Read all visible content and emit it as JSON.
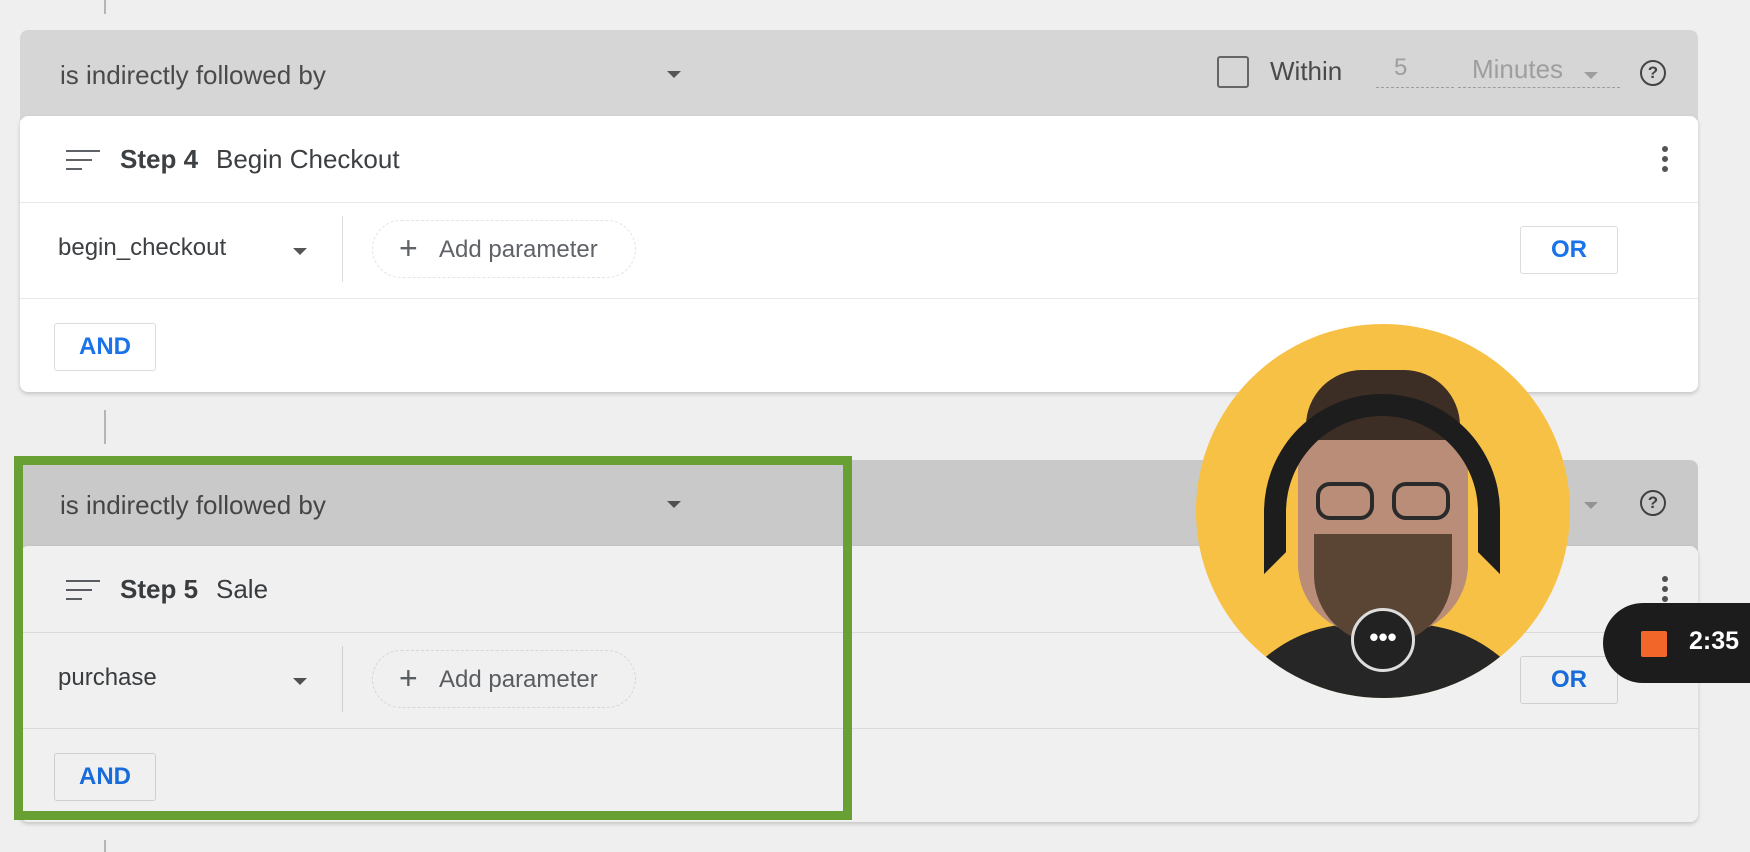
{
  "block1": {
    "condition": "is indirectly followed by",
    "within": {
      "label": "Within",
      "value": "5",
      "unit": "Minutes",
      "checked": false
    },
    "step": {
      "number_label": "Step 4",
      "name": "Begin Checkout"
    },
    "event": "begin_checkout",
    "add_parameter": "Add parameter",
    "or_label": "OR",
    "and_label": "AND"
  },
  "block2": {
    "condition": "is indirectly followed by",
    "step": {
      "number_label": "Step 5",
      "name": "Sale"
    },
    "event": "purchase",
    "add_parameter": "Add parameter",
    "or_label": "OR",
    "and_label": "AND"
  },
  "icons": {
    "sort": "sort-icon",
    "more": "more-vert-icon",
    "help": "help-circle-icon",
    "plus": "plus-icon",
    "dropdown": "dropdown-caret-icon"
  },
  "overlay": {
    "recording_time": "2:35",
    "webcam_menu": "•••",
    "highlight_color": "#69a033"
  },
  "colors": {
    "accent": "#1a73e8",
    "condition_bar": "#d6d6d6",
    "webcam_bg": "#f7c145",
    "record": "#f2662a"
  }
}
